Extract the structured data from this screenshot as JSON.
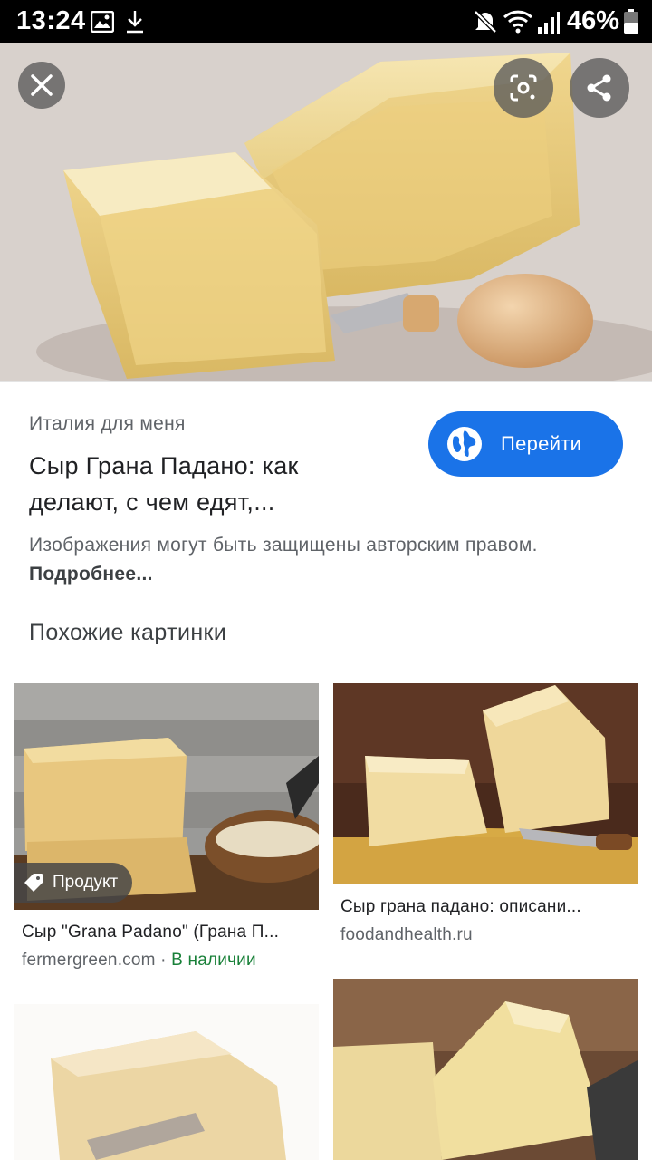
{
  "status_bar": {
    "time": "13:24",
    "battery": "46%"
  },
  "result": {
    "source": "Италия для меня",
    "title": "Сыр Грана Падано: как делают, с чем едят,...",
    "visit_label": "Перейти",
    "copyright_text": "Изображения могут быть защищены авторским правом.",
    "more_link": "Подробнее..."
  },
  "related": {
    "heading": "Похожие картинки",
    "cards": [
      {
        "title": "Сыр \"Grana Padano\" (Грана П...",
        "site": "fermergreen.com",
        "separator": "·",
        "availability": "В наличии",
        "badge": "Продукт"
      },
      {
        "title": "Сыр грана падано: описани...",
        "site": "foodandhealth.ru"
      }
    ]
  },
  "icons": {
    "close": "close-icon",
    "lens": "lens-icon",
    "share": "share-icon",
    "globe": "globe-icon",
    "tag": "tag-icon"
  },
  "colors": {
    "accent": "#1a73e8",
    "in_stock": "#188038",
    "text_secondary": "#5f6368"
  }
}
